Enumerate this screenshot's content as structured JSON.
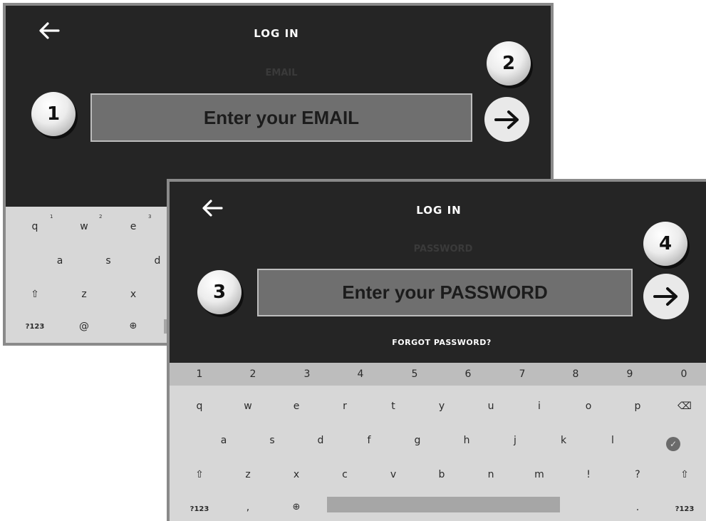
{
  "screen1": {
    "back_icon": "arrow-left-icon",
    "title": "LOG IN",
    "field_label": "EMAIL",
    "field_placeholder": "Enter your EMAIL",
    "step_left": "1",
    "step_right": "2",
    "go_icon": "arrow-right-icon",
    "keyboard": {
      "row1": [
        {
          "key": "q",
          "sup": "1"
        },
        {
          "key": "w",
          "sup": "2"
        },
        {
          "key": "e",
          "sup": "3"
        }
      ],
      "row2": [
        "a",
        "s",
        "d"
      ],
      "row3": [
        "⇧",
        "z",
        "x"
      ],
      "row4": [
        "?123",
        "@",
        "⊕"
      ]
    }
  },
  "screen2": {
    "back_icon": "arrow-left-icon",
    "title": "LOG IN",
    "field_label": "PASSWORD",
    "field_placeholder": "Enter your PASSWORD",
    "step_left": "3",
    "step_right": "4",
    "go_icon": "arrow-right-icon",
    "forgot": "FORGOT PASSWORD?",
    "keyboard": {
      "numbers": [
        "1",
        "2",
        "3",
        "4",
        "5",
        "6",
        "7",
        "8",
        "9",
        "0"
      ],
      "row1": [
        "q",
        "w",
        "e",
        "r",
        "t",
        "y",
        "u",
        "i",
        "o",
        "p",
        "⌫"
      ],
      "row2": [
        "a",
        "s",
        "d",
        "f",
        "g",
        "h",
        "j",
        "k",
        "l",
        "✓"
      ],
      "row3": [
        "⇧",
        "z",
        "x",
        "c",
        "v",
        "b",
        "n",
        "m",
        "!",
        "?",
        "⇧"
      ],
      "row4": [
        "?123",
        ",",
        "⊕",
        ".",
        "?123"
      ]
    }
  }
}
